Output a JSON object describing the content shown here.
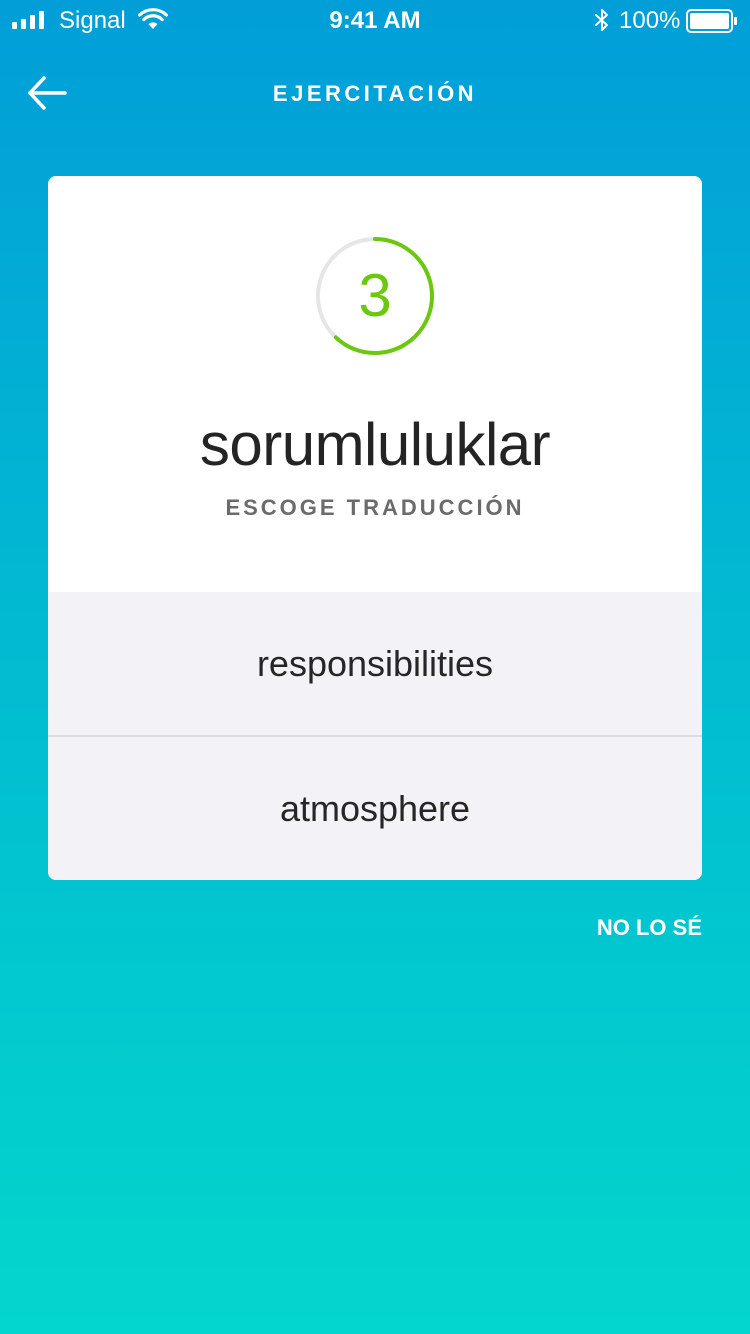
{
  "status_bar": {
    "carrier": "Signal",
    "time": "9:41 AM",
    "battery_percent": "100%",
    "signal_icon": "cellular-signal-icon",
    "wifi_icon": "wifi-icon",
    "bluetooth_icon": "bluetooth-icon",
    "battery_icon": "battery-icon"
  },
  "header": {
    "title": "EJERCITACIÓN",
    "back_icon": "arrow-left-icon"
  },
  "card": {
    "timer": {
      "value": "3",
      "progress_fraction": 0.62,
      "color": "#6cc80e",
      "track_color": "#e6e6e6"
    },
    "word": "sorumluluklar",
    "instruction": "ESCOGE TRADUCCIÓN",
    "options": [
      {
        "label": "responsibilities"
      },
      {
        "label": "atmosphere"
      }
    ]
  },
  "dont_know_label": "NO LO SÉ",
  "colors": {
    "gradient_top": "#019ed8",
    "gradient_bottom": "#03d6cc",
    "option_background": "#f3f2f6"
  }
}
